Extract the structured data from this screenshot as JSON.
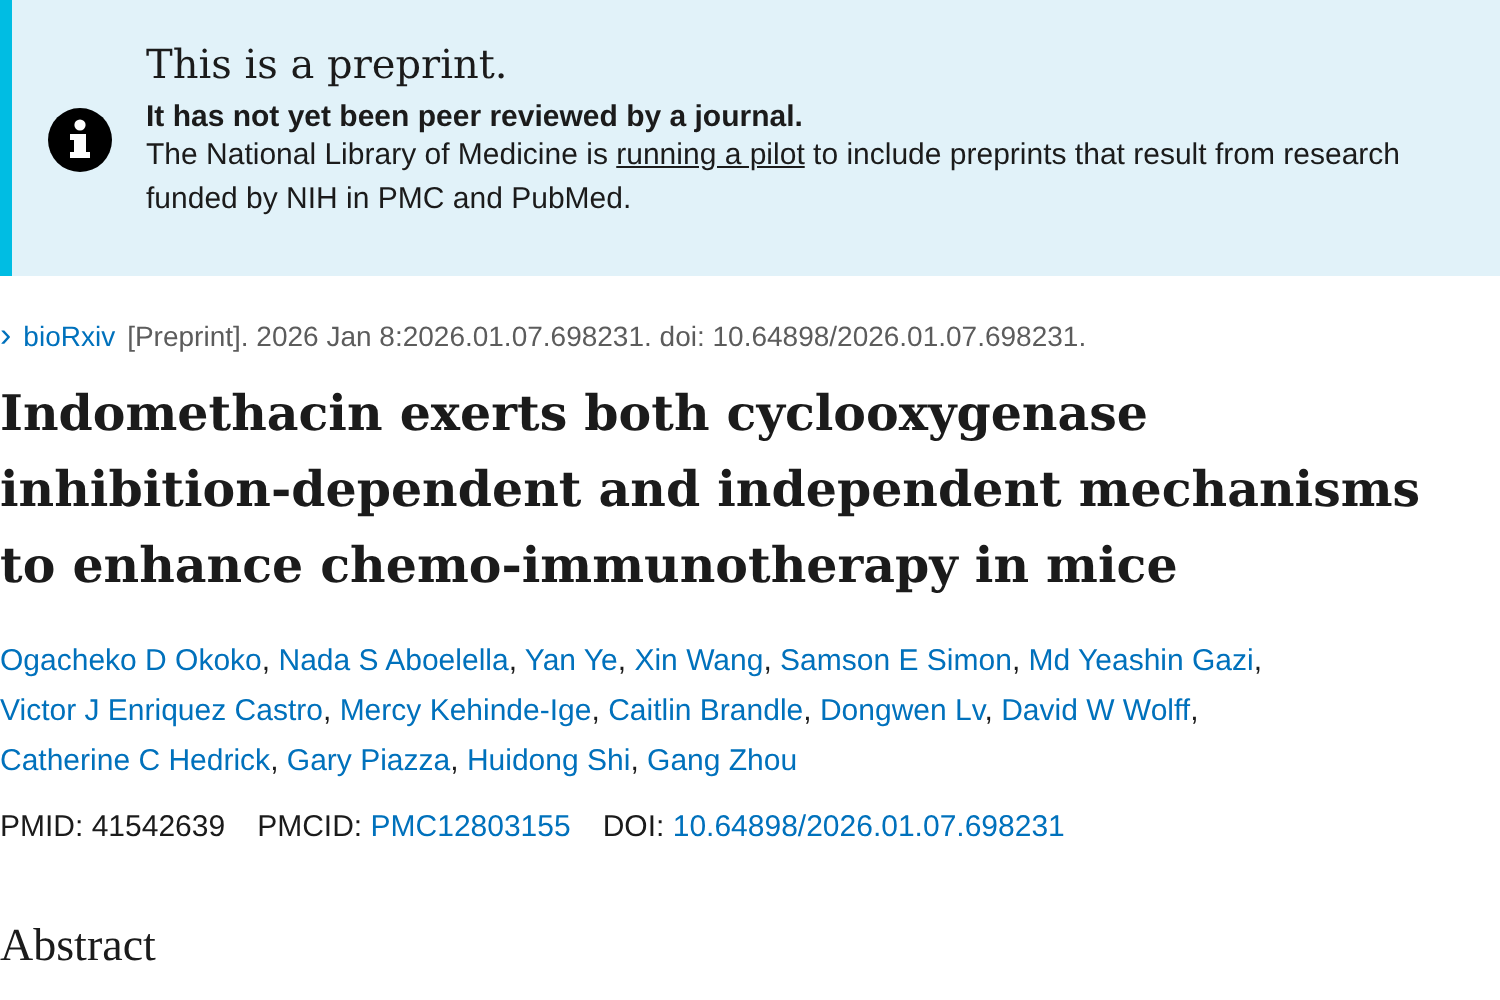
{
  "notice": {
    "title": "This is a preprint.",
    "subtitle": "It has not yet been peer reviewed by a journal.",
    "text_before": "The National Library of Medicine is",
    "link": "running a pilot",
    "text_after": "to include preprints that result from research funded by NIH in PMC and PubMed."
  },
  "citation": {
    "expand_icon": "›",
    "source": "bioRxiv",
    "text": "[Preprint]. 2026 Jan 8:2026.01.07.698231. doi: 10.64898/2026.01.07.698231."
  },
  "title_lines": [
    "Indomethacin exerts both cyclooxygenase",
    "inhibition-dependent and independent mechanisms",
    "to enhance chemo-immunotherapy in mice"
  ],
  "authors": [
    "Ogacheko D Okoko",
    "Nada S Aboelella",
    "Yan Ye",
    "Xin Wang",
    "Samson E Simon",
    "Md Yeashin Gazi",
    "Victor J Enriquez Castro",
    "Mercy Kehinde-Ige",
    "Caitlin Brandle",
    "Dongwen Lv",
    "David W Wolff",
    "Catherine C Hedrick",
    "Gary Piazza",
    "Huidong Shi",
    "Gang Zhou"
  ],
  "author_separator": ",",
  "identifiers": [
    {
      "label": "PMID:",
      "value": "41542639",
      "kind": "text"
    },
    {
      "label": "PMCID:",
      "value": "PMC12803155",
      "kind": "link"
    },
    {
      "label": "DOI:",
      "value": "10.64898/2026.01.07.698231",
      "kind": "link"
    }
  ],
  "section_heading": "Abstract"
}
